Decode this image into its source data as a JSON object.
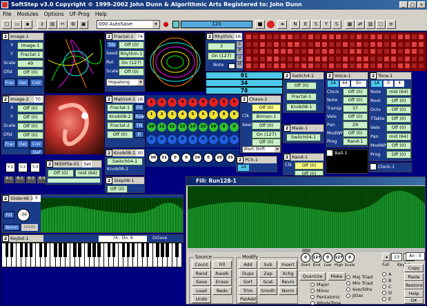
{
  "window": {
    "title": "SoftStep v3.0   Copyright © 1999-2002 John Dunn &  Algorithmic Arts   Registered to: John Dunn",
    "min": "_",
    "max": "□",
    "close": "×"
  },
  "menu": [
    "File",
    "Modules",
    "Options",
    "UF-Prog",
    "Help"
  ],
  "toolbar": {
    "preset": "000 AutoSave",
    "tempo": "120",
    "modes": [
      "N",
      "E",
      "S",
      "Y",
      "S"
    ]
  },
  "image1": {
    "num": "2",
    "title": "Image-1",
    "x_label": "X",
    "x": "Image-1",
    "y_label": "Y",
    "y": "Fractal-1",
    "scale_label": "Scale",
    "scale": "49",
    "ofst_label": "Ofst",
    "ofst": "Off (0)",
    "btns": [
      "Frac",
      "Get",
      "Colr"
    ]
  },
  "image2": {
    "num": "2",
    "title": "Image-2",
    "val": "70",
    "x_label": "X",
    "x": "Off (0)",
    "y_label": "Y",
    "y": "Off (0)",
    "scale_label": "Scale",
    "scale": "Off (0)",
    "ofst_label": "Ofst",
    "ofst": "Off (0)",
    "btns": [
      "Frac",
      "Get",
      "Colr"
    ],
    "def": "Def"
  },
  "fractal1": {
    "num": "2",
    "title": "Fractal-1",
    "val": "74",
    "trb": "Trb",
    "seed_label": "Seed",
    "rot_label": "Rot",
    "scale_label": "Scale",
    "vals": [
      "Off (0)",
      "Rhythm-1",
      "On (127)",
      "Off (0)"
    ],
    "dropdown": "Hopalong"
  },
  "rhythm1": {
    "num": "2",
    "title": "Rhythm-1",
    "val": "16",
    "v1": "3",
    "v2": "On (127)",
    "note": "Note",
    "letters": [
      "C",
      "P",
      "U",
      "M"
    ]
  },
  "bars": [
    "91",
    "34",
    "78"
  ],
  "matrix4": {
    "num": "2",
    "title": "Matrix4-1",
    "val": "16",
    "fill": "Fill",
    "rows": [
      "Fractal-1",
      "Knob08-2",
      "Fractal-2",
      "Off (0)"
    ],
    "side": [
      "Row",
      "TN",
      "R"
    ],
    "cells": [
      "1",
      "2",
      "3",
      "4",
      "5",
      "6",
      "7",
      "8",
      "9",
      "1",
      "2",
      "3",
      "4",
      "5",
      "6",
      "7",
      "8",
      "9",
      "10",
      "11",
      "12",
      "13",
      "14",
      "15",
      "16",
      "0",
      "0",
      "0",
      "0",
      "0",
      "0",
      "0",
      "0",
      "0",
      "0",
      "0"
    ]
  },
  "chaos1": {
    "num": "2",
    "title": "Chaos-1",
    "clk": "Clk",
    "seed": "Seed",
    "vals": [
      "Off (0)",
      "Biimon-1",
      "Off (0)",
      "On (127)",
      "Off (0)"
    ],
    "dropdown": "Blurt Shift"
  },
  "switch4": {
    "num": "2",
    "title": "Switch4-1",
    "vals": [
      "Off (0)",
      "Fractal-1",
      "Knob08-1"
    ]
  },
  "mask1": {
    "num": "2",
    "title": "Mask-1",
    "val": "Switch04-1"
  },
  "rand1": {
    "num": "2",
    "title": "Rand-1",
    "clk": "Clk",
    "vals": [
      "Off (0)",
      "Off (0)"
    ]
  },
  "voice1": {
    "num": "2",
    "title": "Voice-1",
    "v1": "1A",
    "v2": "64",
    "v3": "En",
    "labels": [
      "Clock",
      "Note",
      "Transp",
      "Velo",
      "Pan",
      "ModWh",
      "Prog"
    ],
    "vals": [
      "Off (0)",
      "Off (0)",
      "37",
      "Off (0)",
      "29",
      "Off (0)",
      "Rand-1"
    ]
  },
  "tone1": {
    "num": "2",
    "title": "Tone-1",
    "v1": "1A",
    "v2": "0",
    "v3": "4",
    "labels": [
      "Note",
      "Root",
      "Octv",
      "TTable",
      "Velo",
      "Pan",
      "ModWh",
      "Prog"
    ],
    "vals": [
      "mid (64)",
      "Off (0)",
      "Off (0)",
      "Off (0)",
      "Off (0)",
      "mid (64)",
      "Off (0)",
      "Off (0)"
    ]
  },
  "ball1": {
    "num": "2",
    "title": "Ball-1"
  },
  "clock1": {
    "num": "2",
    "title": "Clock-1"
  },
  "knob08": {
    "num": "2",
    "title": "Knob08-1",
    "val": "30",
    "sw": "Switch04-1",
    "knobs": [
      "30",
      "31",
      "0",
      "0",
      "20",
      "0",
      "20",
      "25"
    ]
  },
  "knob082": {
    "title": "Knob08-2",
    "vals": [
      "Off (0)"
    ]
  },
  "step08": {
    "num": "2",
    "title": "Step08-1",
    "val": "Off (0)"
  },
  "pch": {
    "num": "2",
    "title": "PCh-1",
    "v": "1A"
  },
  "midifile": {
    "num": "2",
    "title": "MIDIFile-01",
    "btn": "Set",
    "vals": [
      "Off (0)",
      "mid (64)"
    ]
  },
  "yblocks": [
    "Y-1",
    "Y-2",
    "Y-3"
  ],
  "bblocks": [
    "B-1",
    "B-2",
    "B-3",
    "B-4"
  ],
  "slider": {
    "num": "2",
    "title": "Slider48-1",
    "val": "5",
    "fill": "Fill",
    "v": "-36",
    "norm": "Norm",
    "undo": "Undo"
  },
  "keybd": {
    "num": "2",
    "title": "Keybd-1",
    "range": "74 : Dn. 6",
    "octave": "Octave"
  },
  "fillwin": {
    "title": "Fill: Run128-1",
    "knobs": [
      {
        "v": "0",
        "l": "Start"
      },
      {
        "v": "127",
        "l": "End"
      },
      {
        "v": "0",
        "l": "Low"
      },
      {
        "v": "127",
        "l": "High"
      },
      {
        "v": "0",
        "l": "Scale"
      }
    ],
    "steps": "13",
    "total": "69",
    "an": "An : 5",
    "full": "Full",
    "keybd": "Keybd",
    "copy": "Copy",
    "paste": "Paste",
    "restore": "Restore",
    "help": "Help",
    "ok": "OK",
    "source": {
      "label": "Source",
      "btns": [
        "Count",
        "Fill",
        "Rand",
        "Rwalk",
        "Save",
        "Erase",
        "Load",
        "Redo",
        "Undo"
      ]
    },
    "modify": {
      "label": "Modify",
      "btns": [
        "Add",
        "Sub",
        "Insert",
        "Dups",
        "Zap",
        "Xchg",
        "Sort",
        "Scat",
        "Revrs",
        "Trim",
        "Smoth",
        "Norm",
        "PatAdd"
      ]
    },
    "quantize": "Quantize",
    "make": "Make",
    "scales_l": [
      "Major",
      "Minor",
      "Pentatonic",
      "WholeTone"
    ],
    "scales_r": [
      "Maj Triad",
      "Min Triad",
      "6ve/5ths",
      "Jitter"
    ],
    "abc": [
      "A",
      "B",
      "C",
      "D",
      "E"
    ]
  }
}
